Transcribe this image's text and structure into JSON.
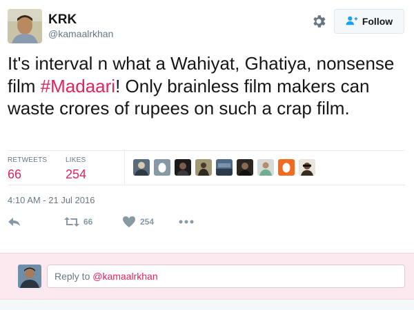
{
  "author": {
    "display_name": "KRK",
    "handle": "@kamaalrkhan"
  },
  "header": {
    "follow_label": "Follow"
  },
  "tweet": {
    "text_before": "It's interval n what a Wahiyat, Ghatiya, nonsense film ",
    "hashtag": "#Madaari",
    "text_after": "! Only brainless film makers can waste crores of rupees on such a crap film.",
    "timestamp": "4:10 AM - 21 Jul 2016"
  },
  "stats": {
    "retweets_label": "RETWEETS",
    "retweets_value": "66",
    "likes_label": "LIKES",
    "likes_value": "254"
  },
  "actions": {
    "retweet_count": "66",
    "like_count": "254"
  },
  "reply": {
    "prefix": "Reply to ",
    "mention": "@kamaalrkhan"
  },
  "colors": {
    "accent": "#e0245e",
    "muted": "#657786",
    "icon": "#8899a6",
    "reply_bg": "#fce9f0"
  },
  "likers": [
    {
      "icon": "avatar-photo"
    },
    {
      "icon": "default-egg-avatar"
    },
    {
      "icon": "avatar-photo"
    },
    {
      "icon": "avatar-photo"
    },
    {
      "icon": "avatar-photo"
    },
    {
      "icon": "avatar-photo"
    },
    {
      "icon": "avatar-photo"
    },
    {
      "icon": "default-egg-avatar"
    },
    {
      "icon": "avatar-photo"
    }
  ]
}
